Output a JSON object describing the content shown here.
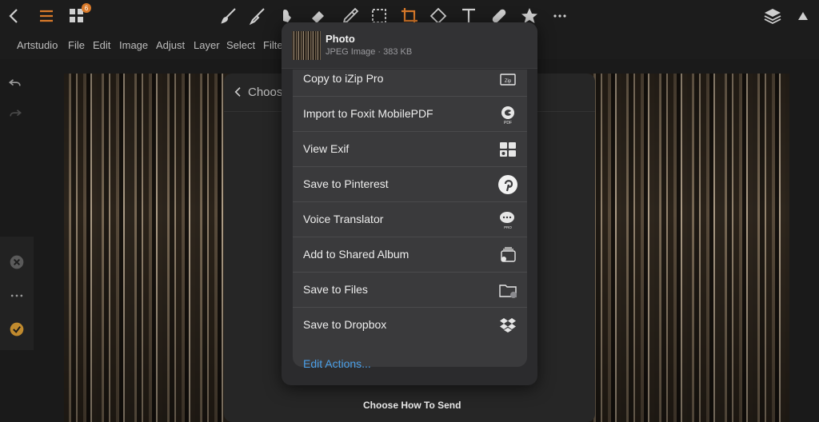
{
  "app": {
    "menu": [
      "Artstudio",
      "File",
      "Edit",
      "Image",
      "Adjust",
      "Layer",
      "Select",
      "Filte"
    ],
    "layers_badge": "6"
  },
  "colors": {
    "accent": "#d97a2a",
    "link": "#4a9fe8",
    "popover_bg": "#2b2b2d",
    "row_bg": "#3a3a3c"
  },
  "choose_dialog": {
    "back_label": "Choose",
    "footer": "Choose How To Send"
  },
  "share": {
    "file_title": "Photo",
    "file_sub": "JPEG Image · 383 KB",
    "actions": [
      {
        "label": "Copy to iZip Pro",
        "icon": "zip-icon"
      },
      {
        "label": "Import to Foxit MobilePDF",
        "icon": "foxit-pdf-icon"
      },
      {
        "label": "View Exif",
        "icon": "exif-icon"
      },
      {
        "label": "Save to Pinterest",
        "icon": "pinterest-icon"
      },
      {
        "label": "Voice Translator",
        "icon": "voice-translator-icon"
      },
      {
        "label": "Add to Shared Album",
        "icon": "shared-album-icon"
      },
      {
        "label": "Save to Files",
        "icon": "folder-icon"
      },
      {
        "label": "Save to Dropbox",
        "icon": "dropbox-icon"
      }
    ],
    "edit_actions": "Edit Actions..."
  }
}
